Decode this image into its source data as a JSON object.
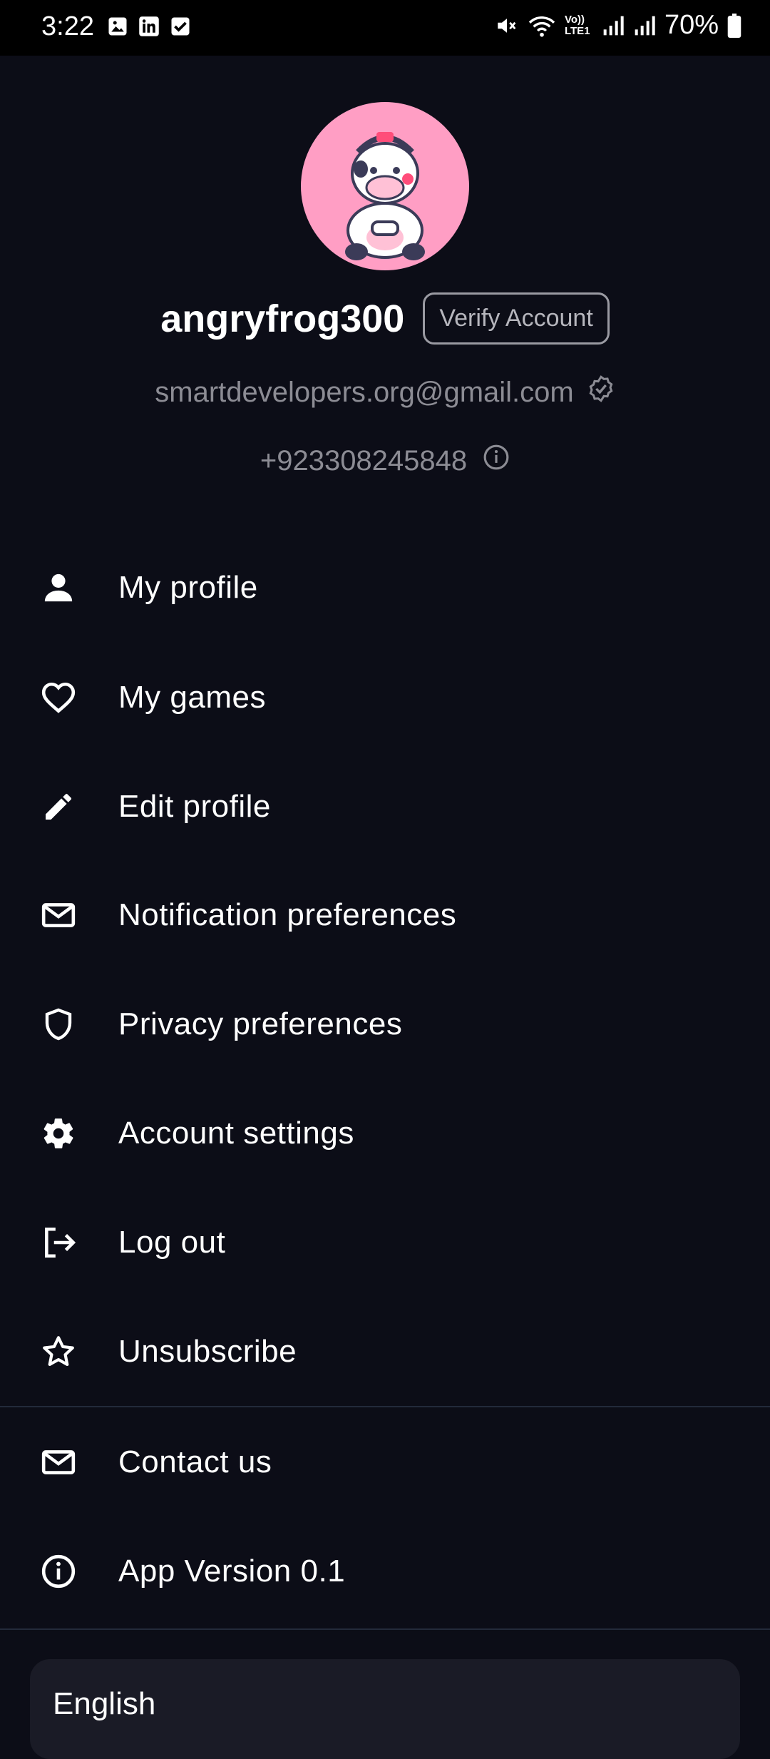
{
  "status_bar": {
    "time": "3:22",
    "battery_percent": "70%",
    "network_label": "Vo)) LTE1",
    "left_icons": [
      "gallery-icon",
      "linkedin-icon",
      "checkbox-icon"
    ],
    "right_icons": [
      "mute-icon",
      "wifi-icon",
      "volte-icon",
      "signal-icon",
      "signal-icon",
      "battery-icon"
    ]
  },
  "profile": {
    "username": "angryfrog300",
    "verify_label": "Verify Account",
    "email": "smartdevelopers.org@gmail.com",
    "phone": "+923308245848",
    "avatar_bg": "#ff9ec4"
  },
  "menu": {
    "items": [
      {
        "label": "My profile",
        "icon": "person-icon"
      },
      {
        "label": "My games",
        "icon": "heart-icon"
      },
      {
        "label": "Edit profile",
        "icon": "pencil-icon"
      },
      {
        "label": "Notification preferences",
        "icon": "mail-icon"
      },
      {
        "label": "Privacy preferences",
        "icon": "shield-icon"
      },
      {
        "label": "Account settings",
        "icon": "gear-icon"
      },
      {
        "label": "Log out",
        "icon": "logout-icon"
      },
      {
        "label": "Unsubscribe",
        "icon": "star-icon"
      }
    ],
    "secondary": [
      {
        "label": "Contact us",
        "icon": "mail-icon"
      },
      {
        "label": "App Version 0.1",
        "icon": "info-icon"
      }
    ]
  },
  "language": {
    "selected": "English"
  },
  "colors": {
    "background": "#0c0d17",
    "muted_text": "#8c8c94",
    "divider": "#232a3a"
  }
}
